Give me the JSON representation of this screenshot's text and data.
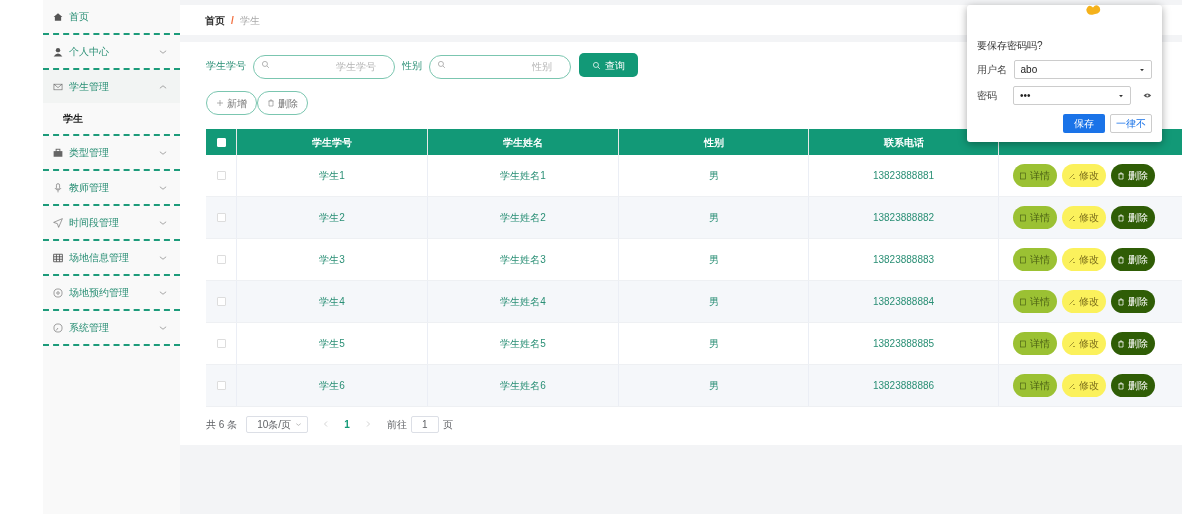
{
  "sidebar": {
    "items": [
      {
        "label": "首页",
        "kind": "link"
      },
      {
        "label": "个人中心",
        "kind": "submenu",
        "expanded": false
      },
      {
        "label": "学生管理",
        "kind": "submenu",
        "expanded": true,
        "children": [
          {
            "label": "学生"
          }
        ]
      },
      {
        "label": "类型管理",
        "kind": "submenu",
        "expanded": false
      },
      {
        "label": "教师管理",
        "kind": "submenu",
        "expanded": false
      },
      {
        "label": "时间段管理",
        "kind": "submenu",
        "expanded": false
      },
      {
        "label": "场地信息管理",
        "kind": "submenu",
        "expanded": false
      },
      {
        "label": "场地预约管理",
        "kind": "submenu",
        "expanded": false
      },
      {
        "label": "系统管理",
        "kind": "submenu",
        "expanded": false
      }
    ]
  },
  "breadcrumb": {
    "items": [
      "首页",
      "学生"
    ],
    "separator": "/"
  },
  "search": {
    "fields": [
      {
        "label": "学生学号",
        "placeholder": "学生学号"
      },
      {
        "label": "性别",
        "placeholder": "性别"
      }
    ],
    "button": "查询"
  },
  "toolbar": [
    {
      "label": "新增",
      "kind": "add"
    },
    {
      "label": "删除",
      "kind": "delete"
    }
  ],
  "table": {
    "columns": [
      "学生学号",
      "学生姓名",
      "性别",
      "联系电话"
    ],
    "header_checked": false,
    "rows": [
      {
        "checked": false,
        "cells": [
          "学生1",
          "学生姓名1",
          "男",
          "13823888881"
        ],
        "actions": [
          {
            "label": "详情",
            "kind": "detail"
          },
          {
            "label": "修改",
            "kind": "edit"
          },
          {
            "label": "删除",
            "kind": "delete"
          }
        ]
      },
      {
        "checked": false,
        "cells": [
          "学生2",
          "学生姓名2",
          "男",
          "13823888882"
        ],
        "actions": [
          {
            "label": "详情",
            "kind": "detail"
          },
          {
            "label": "修改",
            "kind": "edit"
          },
          {
            "label": "删除",
            "kind": "delete"
          }
        ]
      },
      {
        "checked": false,
        "cells": [
          "学生3",
          "学生姓名3",
          "男",
          "13823888883"
        ],
        "actions": [
          {
            "label": "详情",
            "kind": "detail"
          },
          {
            "label": "修改",
            "kind": "edit"
          },
          {
            "label": "删除",
            "kind": "delete"
          }
        ]
      },
      {
        "checked": false,
        "cells": [
          "学生4",
          "学生姓名4",
          "男",
          "13823888884"
        ],
        "actions": [
          {
            "label": "详情",
            "kind": "detail"
          },
          {
            "label": "修改",
            "kind": "edit"
          },
          {
            "label": "删除",
            "kind": "delete"
          }
        ]
      },
      {
        "checked": false,
        "cells": [
          "学生5",
          "学生姓名5",
          "男",
          "13823888885"
        ],
        "actions": [
          {
            "label": "详情",
            "kind": "detail"
          },
          {
            "label": "修改",
            "kind": "edit"
          },
          {
            "label": "删除",
            "kind": "delete"
          }
        ]
      },
      {
        "checked": false,
        "cells": [
          "学生6",
          "学生姓名6",
          "男",
          "13823888886"
        ],
        "actions": [
          {
            "label": "详情",
            "kind": "detail"
          },
          {
            "label": "修改",
            "kind": "edit"
          },
          {
            "label": "删除",
            "kind": "delete"
          }
        ]
      }
    ]
  },
  "pagination": {
    "total": "共 6 条",
    "page_size": "10条/页",
    "pages": [
      {
        "label": "1",
        "selected": true
      }
    ],
    "goto_label": "前往",
    "goto_value": "1",
    "goto_suffix": "页"
  },
  "save_password_popup": {
    "title": "要保存密码吗?",
    "fields": [
      {
        "label": "用户名",
        "value": "abo"
      },
      {
        "label": "密码",
        "value": "•••"
      }
    ],
    "buttons": [
      {
        "label": "保存",
        "kind": "primary"
      },
      {
        "label": "一律不",
        "kind": "secondary"
      }
    ]
  }
}
